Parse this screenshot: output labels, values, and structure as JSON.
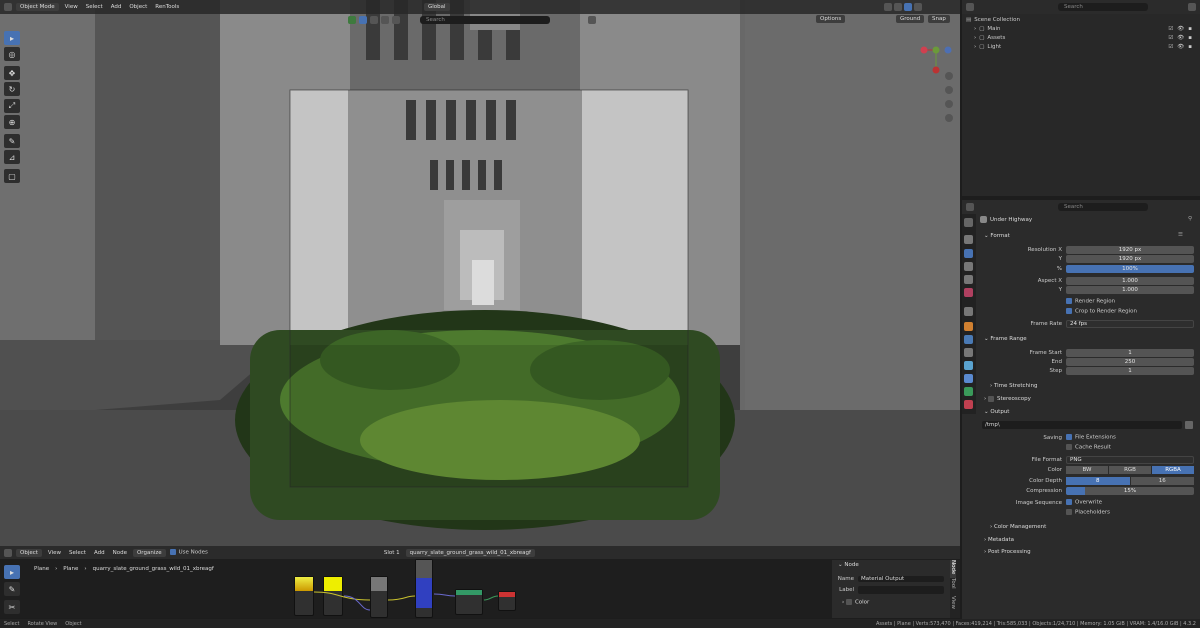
{
  "topbar": {
    "mode": "Object Mode",
    "menus": [
      "View",
      "Select",
      "Add",
      "Object",
      "RenTools"
    ],
    "transform": "Global",
    "search_placeholder": "Search",
    "options": "Options",
    "snap_target": "Ground",
    "snap": "Snap"
  },
  "outliner": {
    "search_placeholder": "Search",
    "root": "Scene Collection",
    "items": [
      {
        "label": "Main"
      },
      {
        "label": "Assets"
      },
      {
        "label": "Light"
      }
    ]
  },
  "properties": {
    "search_placeholder": "Search",
    "scene_name": "Under Highway",
    "format": {
      "title": "Format",
      "res_x_label": "Resolution X",
      "res_x": "1920 px",
      "res_y_label": "Y",
      "res_y": "1920 px",
      "pct_label": "%",
      "pct": "100%",
      "aspect_x_label": "Aspect X",
      "aspect_x": "1.000",
      "aspect_y_label": "Y",
      "aspect_y": "1.000",
      "render_region": "Render Region",
      "crop": "Crop to Render Region",
      "frame_rate_label": "Frame Rate",
      "frame_rate": "24 fps"
    },
    "frame_range": {
      "title": "Frame Range",
      "start_label": "Frame Start",
      "start": "1",
      "end_label": "End",
      "end": "250",
      "step_label": "Step",
      "step": "1",
      "time_stretching": "Time Stretching"
    },
    "stereoscopy": "Stereoscopy",
    "output": {
      "title": "Output",
      "path": "/tmp\\",
      "saving_label": "Saving",
      "file_ext": "File Extensions",
      "cache": "Cache Result",
      "format_label": "File Format",
      "format": "PNG",
      "color_label": "Color",
      "color_opts": [
        "BW",
        "RGB",
        "RGBA"
      ],
      "depth_label": "Color Depth",
      "depth_opts": [
        "8",
        "16"
      ],
      "compression_label": "Compression",
      "compression": "15%",
      "compression_value": 0.15,
      "seq_label": "Image Sequence",
      "overwrite": "Overwrite",
      "placeholders": "Placeholders",
      "color_mgmt": "Color Management"
    },
    "metadata": "Metadata",
    "post": "Post Processing"
  },
  "node_editor": {
    "editor": "Object",
    "menus": [
      "View",
      "Select",
      "Add",
      "Node"
    ],
    "organize": "Organize",
    "use_nodes": "Use Nodes",
    "slot": "Slot 1",
    "material": "quarry_slate_ground_grass_wild_01_xbreagf",
    "breadcrumb": [
      "Plane",
      "Plane",
      "quarry_slate_ground_grass_wild_01_xbreagf"
    ],
    "panel": {
      "title": "Node",
      "name_label": "Name",
      "name": "Material Output",
      "label_label": "Label",
      "color": "Color"
    },
    "tabs": [
      "Node",
      "Tool",
      "View"
    ]
  },
  "statusbar": {
    "left": [
      "Select",
      "Rotate View",
      "Object"
    ],
    "right": "Assets | Plane | Verts:573,470 | Faces:419,214 | Tris:585,033 | Objects:1/24,710 | Memory: 1.05 GiB | VRAM: 1.4/16.0 GiB | 4.3.2"
  }
}
